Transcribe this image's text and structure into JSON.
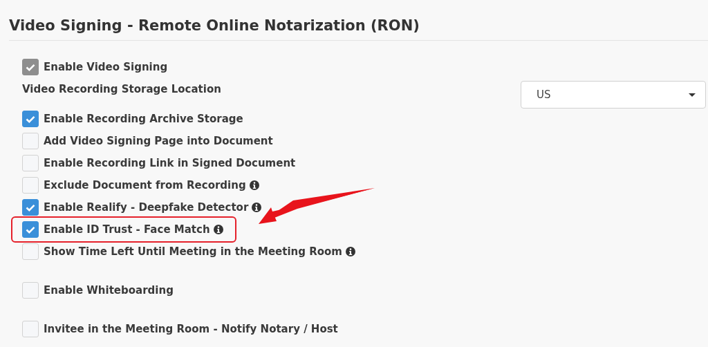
{
  "title": "Video Signing - Remote Online Notarization (RON)",
  "groups": [
    {
      "settings": [
        {
          "kind": "checkbox",
          "label": "Enable Video Signing",
          "checked": true,
          "disabled": true,
          "info": false,
          "highlighted": false
        },
        {
          "kind": "select",
          "label": "Video Recording Storage Location",
          "value": "US"
        },
        {
          "kind": "checkbox",
          "label": "Enable Recording Archive Storage",
          "checked": true,
          "disabled": false,
          "info": false,
          "highlighted": false
        },
        {
          "kind": "checkbox",
          "label": "Add Video Signing Page into Document",
          "checked": false,
          "disabled": false,
          "info": false,
          "highlighted": false
        },
        {
          "kind": "checkbox",
          "label": "Enable Recording Link in Signed Document",
          "checked": false,
          "disabled": false,
          "info": false,
          "highlighted": false
        },
        {
          "kind": "checkbox",
          "label": "Exclude Document from Recording",
          "checked": false,
          "disabled": false,
          "info": true,
          "highlighted": false
        },
        {
          "kind": "checkbox",
          "label": "Enable Realify - Deepfake Detector",
          "checked": true,
          "disabled": false,
          "info": true,
          "highlighted": false
        },
        {
          "kind": "checkbox",
          "label": "Enable ID Trust - Face Match",
          "checked": true,
          "disabled": false,
          "info": true,
          "highlighted": true
        },
        {
          "kind": "checkbox",
          "label": "Show Time Left Until Meeting in the Meeting Room",
          "checked": false,
          "disabled": false,
          "info": true,
          "highlighted": false
        }
      ]
    },
    {
      "settings": [
        {
          "kind": "checkbox",
          "label": "Enable Whiteboarding",
          "checked": false,
          "disabled": false,
          "info": false,
          "highlighted": false
        }
      ]
    },
    {
      "settings": [
        {
          "kind": "checkbox",
          "label": "Invitee in the Meeting Room - Notify Notary / Host",
          "checked": false,
          "disabled": false,
          "info": false,
          "highlighted": false
        }
      ]
    }
  ]
}
